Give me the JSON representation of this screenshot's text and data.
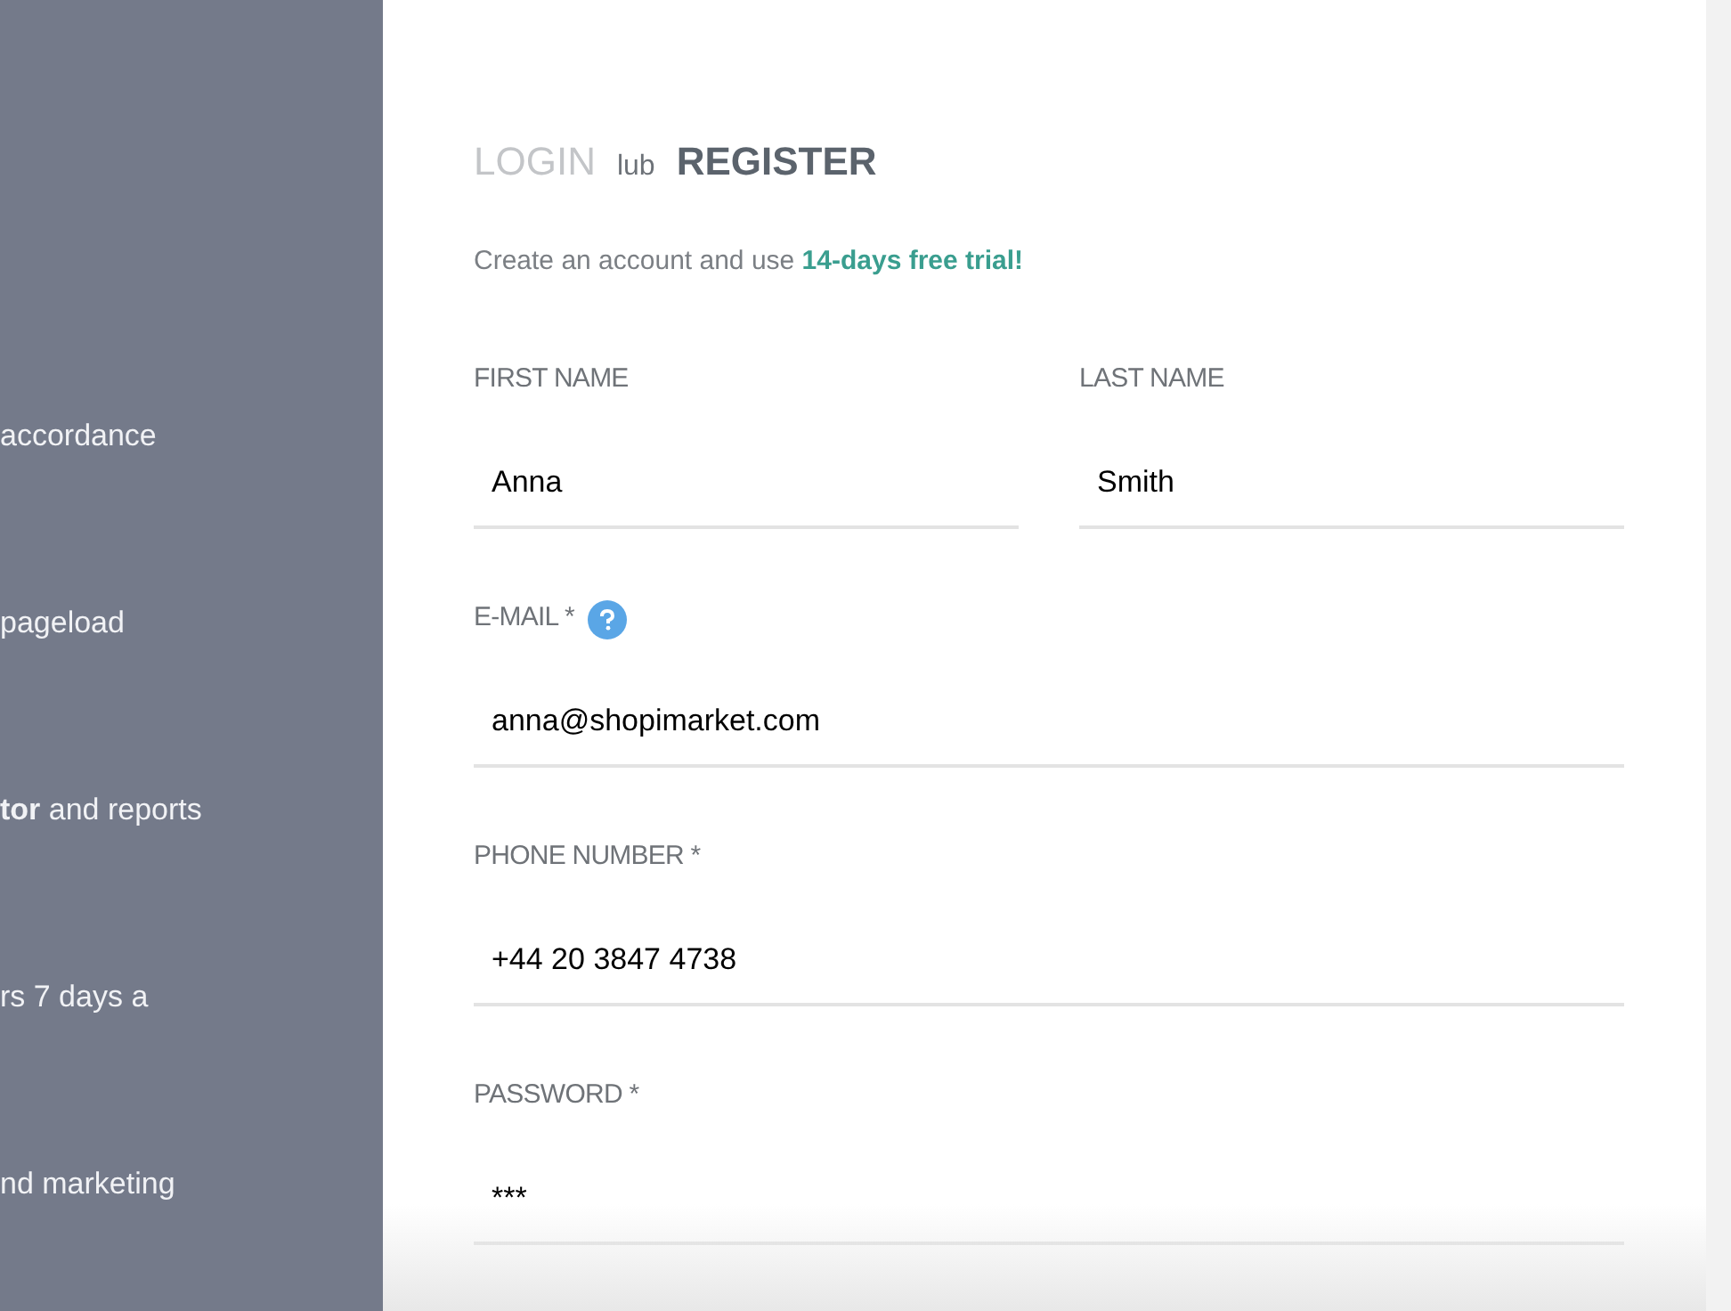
{
  "side_panel": {
    "lines": [
      "accordance",
      "pageload",
      "**tor** and reports",
      "rs 7 days a",
      "nd marketing"
    ]
  },
  "header": [
    {
      "kind": "tab",
      "label": "LOGIN",
      "selected": false
    },
    {
      "kind": "text",
      "label": "lub"
    },
    {
      "kind": "tab",
      "label": "REGISTER",
      "selected": true
    }
  ],
  "subtitle": "Create an account and use **14-days free trial!**",
  "name_fields": [
    {
      "label": "FIRST NAME",
      "value": "Anna"
    },
    {
      "label": "LAST NAME",
      "value": "Smith"
    }
  ],
  "fields": [
    {
      "label": "E-MAIL *",
      "help": true,
      "value": "anna@shopimarket.com"
    },
    {
      "label": "PHONE NUMBER *",
      "help": false,
      "value": "+44 20 3847 4738"
    },
    {
      "label": "PASSWORD *",
      "help": false,
      "value": "***"
    }
  ]
}
